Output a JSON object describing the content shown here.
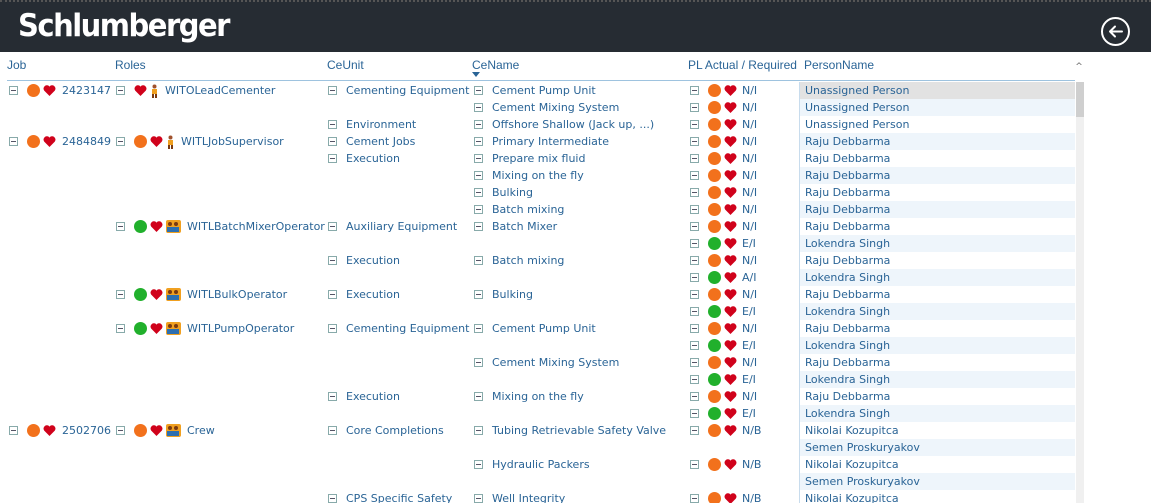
{
  "app": {
    "logo_text": "Schlumberger",
    "back_icon": "back-arrow-circle-icon"
  },
  "columns": {
    "job": "Job",
    "roles": "Roles",
    "ceunit": "CeUnit",
    "cename": "CeName",
    "pl": "PL Actual / Required",
    "person": "PersonName"
  },
  "colors": {
    "topbar": "#262c33",
    "link_text": "#2a6496",
    "status_orange": "#f2711c",
    "status_green": "#21b02c",
    "heart_red": "#d0021b",
    "row_alt": "#eef5fb"
  },
  "rows": [
    {
      "job": "2423147",
      "job_status": "orange",
      "role": "WITOLeadCementer",
      "role_status": "none",
      "role_icon": "person",
      "ceunit": "Cementing Equipment",
      "cename": "Cement Pump Unit",
      "pl_status": "orange",
      "pl": "N/I",
      "person": "Unassigned Person"
    },
    {
      "cename": "Cement Mixing System",
      "pl_status": "orange",
      "pl": "N/I",
      "person": "Unassigned Person"
    },
    {
      "ceunit": "Environment",
      "cename": "Offshore Shallow (Jack up, ...)",
      "pl_status": "orange",
      "pl": "N/I",
      "person": "Unassigned Person"
    },
    {
      "job": "2484849",
      "job_status": "orange",
      "role": "WITLJobSupervisor",
      "role_status": "orange",
      "role_icon": "person",
      "ceunit": "Cement Jobs",
      "cename": "Primary Intermediate",
      "pl_status": "orange",
      "pl": "N/I",
      "person": "Raju Debbarma"
    },
    {
      "ceunit": "Execution",
      "cename": "Prepare mix fluid",
      "pl_status": "orange",
      "pl": "N/I",
      "person": "Raju Debbarma"
    },
    {
      "cename": "Mixing on the fly",
      "pl_status": "orange",
      "pl": "N/I",
      "person": "Raju Debbarma"
    },
    {
      "cename": "Bulking",
      "pl_status": "orange",
      "pl": "N/I",
      "person": "Raju Debbarma"
    },
    {
      "cename": "Batch mixing",
      "pl_status": "orange",
      "pl": "N/I",
      "person": "Raju Debbarma"
    },
    {
      "role": "WITLBatchMixerOperator",
      "role_status": "green",
      "role_icon": "crew",
      "ceunit": "Auxiliary Equipment",
      "cename": "Batch Mixer",
      "pl_status": "orange",
      "pl": "N/I",
      "person": "Raju Debbarma"
    },
    {
      "pl_status": "green",
      "pl": "E/I",
      "pl_expander": true,
      "person": "Lokendra Singh"
    },
    {
      "ceunit": "Execution",
      "cename": "Batch mixing",
      "pl_status": "orange",
      "pl": "N/I",
      "person": "Raju Debbarma"
    },
    {
      "pl_status": "green",
      "pl": "A/I",
      "pl_expander": true,
      "person": "Lokendra Singh"
    },
    {
      "role": "WITLBulkOperator",
      "role_status": "green",
      "role_icon": "crew",
      "ceunit": "Execution",
      "cename": "Bulking",
      "pl_status": "orange",
      "pl": "N/I",
      "person": "Raju Debbarma"
    },
    {
      "pl_status": "green",
      "pl": "E/I",
      "pl_expander": true,
      "person": "Lokendra Singh"
    },
    {
      "role": "WITLPumpOperator",
      "role_status": "green",
      "role_icon": "crew",
      "ceunit": "Cementing Equipment",
      "cename": "Cement Pump Unit",
      "pl_status": "orange",
      "pl": "N/I",
      "person": "Raju Debbarma"
    },
    {
      "pl_status": "green",
      "pl": "E/I",
      "pl_expander": true,
      "person": "Lokendra Singh"
    },
    {
      "cename": "Cement Mixing System",
      "pl_status": "orange",
      "pl": "N/I",
      "person": "Raju Debbarma"
    },
    {
      "pl_status": "green",
      "pl": "E/I",
      "pl_expander": true,
      "person": "Lokendra Singh"
    },
    {
      "ceunit": "Execution",
      "cename": "Mixing on the fly",
      "pl_status": "orange",
      "pl": "N/I",
      "person": "Raju Debbarma"
    },
    {
      "pl_status": "green",
      "pl": "E/I",
      "pl_expander": true,
      "person": "Lokendra Singh"
    },
    {
      "job": "2502706",
      "job_status": "orange",
      "role": "Crew",
      "role_status": "orange",
      "role_icon": "crew",
      "ceunit": "Core Completions",
      "cename": "Tubing Retrievable Safety Valve",
      "pl_status": "orange",
      "pl": "N/B",
      "person": "Nikolai Kozupitca"
    },
    {
      "person": "Semen Proskuryakov",
      "pl_status": "none"
    },
    {
      "cename": "Hydraulic Packers",
      "pl_status": "orange",
      "pl": "N/B",
      "person": "Nikolai Kozupitca"
    },
    {
      "person": "Semen Proskuryakov",
      "pl_status": "none"
    },
    {
      "ceunit": "CPS Specific Safety",
      "cename": "Well Integrity",
      "pl_status": "orange",
      "pl": "N/B",
      "person": "Nikolai Kozupitca"
    }
  ]
}
